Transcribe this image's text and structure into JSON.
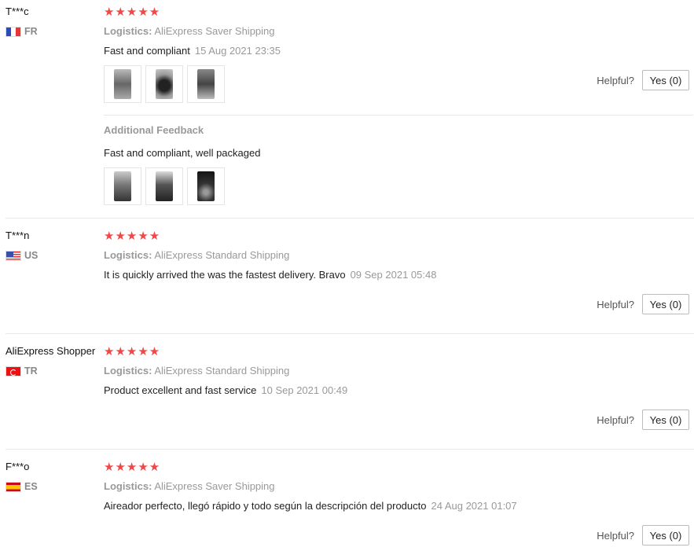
{
  "colors": {
    "star": "#f04848",
    "muted": "#999999",
    "border": "#e8e8e8"
  },
  "reviews": [
    {
      "user": "T***c",
      "country": "FR",
      "flag": "france-flag-icon",
      "stars": "★★★★★",
      "logistics_label": "Logistics:",
      "logistics": "AliExpress Saver Shipping",
      "text": "Fast and compliant",
      "date": "15 Aug 2021 23:35",
      "additional_title": "Additional Feedback",
      "additional_text": "Fast and compliant, well packaged",
      "helpful_label": "Helpful?",
      "yes_label": "Yes (0)"
    },
    {
      "user": "T***n",
      "country": "US",
      "flag": "usa-flag-icon",
      "stars": "★★★★★",
      "logistics_label": "Logistics:",
      "logistics": "AliExpress Standard Shipping",
      "text": "It is quickly arrived the was the fastest delivery. Bravo",
      "date": "09 Sep 2021 05:48",
      "helpful_label": "Helpful?",
      "yes_label": "Yes (0)"
    },
    {
      "user": "AliExpress Shopper",
      "country": "TR",
      "flag": "turkey-flag-icon",
      "stars": "★★★★★",
      "logistics_label": "Logistics:",
      "logistics": "AliExpress Standard Shipping",
      "text": "Product excellent and fast service",
      "date": "10 Sep 2021 00:49",
      "helpful_label": "Helpful?",
      "yes_label": "Yes (0)"
    },
    {
      "user": "F***o",
      "country": "ES",
      "flag": "spain-flag-icon",
      "stars": "★★★★★",
      "logistics_label": "Logistics:",
      "logistics": "AliExpress Saver Shipping",
      "text": "Aireador perfecto, llegó rápido y todo según la descripción del producto",
      "date": "24 Aug 2021 01:07",
      "helpful_label": "Helpful?",
      "yes_label": "Yes (0)"
    }
  ]
}
